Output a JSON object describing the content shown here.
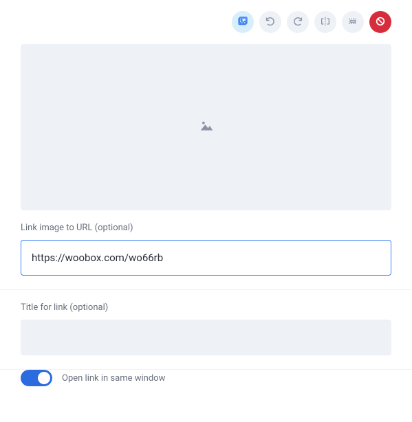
{
  "toolbar": {
    "icons": [
      "image",
      "undo",
      "redo",
      "flip-horizontal",
      "crop",
      "cancel"
    ]
  },
  "link": {
    "label": "Link image to URL (optional)",
    "value": "https://woobox.com/wo66rb",
    "parts": {
      "p1": "https",
      "p2": "://",
      "p3": "woobox",
      "p4": ".com/",
      "p5": "wo66rb"
    }
  },
  "title": {
    "label": "Title for link (optional)",
    "value": ""
  },
  "toggle": {
    "label": "Open link in same window",
    "on": true
  }
}
